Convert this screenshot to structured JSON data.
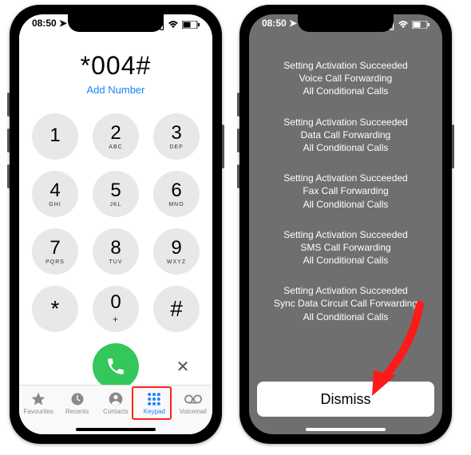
{
  "statusbar": {
    "time": "08:50"
  },
  "left": {
    "dialed": "*004#",
    "add_number": "Add Number",
    "keys": [
      {
        "digit": "1",
        "letters": ""
      },
      {
        "digit": "2",
        "letters": "ABC"
      },
      {
        "digit": "3",
        "letters": "DEF"
      },
      {
        "digit": "4",
        "letters": "GHI"
      },
      {
        "digit": "5",
        "letters": "JKL"
      },
      {
        "digit": "6",
        "letters": "MNO"
      },
      {
        "digit": "7",
        "letters": "PQRS"
      },
      {
        "digit": "8",
        "letters": "TUV"
      },
      {
        "digit": "9",
        "letters": "WXYZ"
      },
      {
        "digit": "*",
        "letters": ""
      },
      {
        "digit": "0",
        "letters": "+"
      },
      {
        "digit": "#",
        "letters": ""
      }
    ],
    "tabs": [
      {
        "id": "favourites",
        "label": "Favourites"
      },
      {
        "id": "recents",
        "label": "Recents"
      },
      {
        "id": "contacts",
        "label": "Contacts"
      },
      {
        "id": "keypad",
        "label": "Keypad"
      },
      {
        "id": "voicemail",
        "label": "Voicemail"
      }
    ]
  },
  "right": {
    "messages": [
      [
        "Setting Activation Succeeded",
        "Voice Call Forwarding",
        "All Conditional Calls"
      ],
      [
        "Setting Activation Succeeded",
        "Data Call Forwarding",
        "All Conditional Calls"
      ],
      [
        "Setting Activation Succeeded",
        "Fax Call Forwarding",
        "All Conditional Calls"
      ],
      [
        "Setting Activation Succeeded",
        "SMS Call Forwarding",
        "All Conditional Calls"
      ],
      [
        "Setting Activation Succeeded",
        "Sync Data Circuit Call Forwarding",
        "All Conditional Calls"
      ]
    ],
    "dismiss": "Dismiss"
  }
}
